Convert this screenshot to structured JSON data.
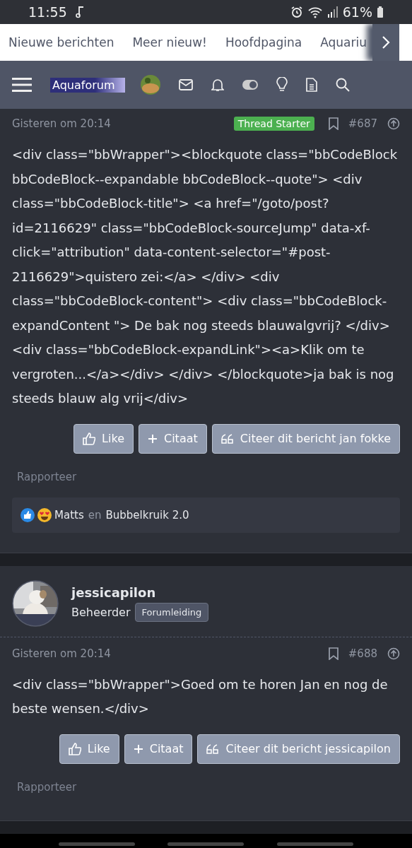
{
  "status_bar": {
    "time": "11:55",
    "battery": "61%"
  },
  "nav_tabs": [
    {
      "label": "Nieuwe berichten"
    },
    {
      "label": "Meer nieuw!"
    },
    {
      "label": "Hoofdpagina"
    },
    {
      "label": "Aquariu"
    }
  ],
  "header": {
    "logo": "Aquaforum"
  },
  "posts": [
    {
      "date": "Gisteren om 20:14",
      "badge": "Thread Starter",
      "number": "#687",
      "body": "<div class=\"bbWrapper\"><blockquote class=\"bbCodeBlock bbCodeBlock--expandable bbCodeBlock--quote\"> <div class=\"bbCodeBlock-title\"> <a href=\"/goto/post?id=2116629\" class=\"bbCodeBlock-sourceJump\" data-xf-click=\"attribution\" data-content-selector=\"#post-2116629\">quistero zei:</a> </div> <div class=\"bbCodeBlock-content\"> <div class=\"bbCodeBlock-expandContent \"> De bak nog steeds blauwalgvrij? </div> <div class=\"bbCodeBlock-expandLink\"><a>Klik om te vergroten...</a></div> </div> </blockquote>ja bak is nog steeds blauw alg vrij</div>",
      "buttons": [
        "Like",
        "Citaat",
        "Citeer dit bericht jan fokke"
      ],
      "report": "Rapporteer",
      "reactions": {
        "users": [
          "Matts",
          "Bubbelkruik 2.0"
        ],
        "joiner": "en"
      }
    },
    {
      "author": {
        "name": "jessicapilon",
        "role": "Beheerder",
        "tag": "Forumleiding"
      },
      "date": "Gisteren om 20:14",
      "number": "#688",
      "body": "<div class=\"bbWrapper\">Goed om te horen Jan en nog de beste wensen.</div>",
      "buttons": [
        "Like",
        "Citaat",
        "Citeer dit bericht jessicapilon"
      ],
      "report": "Rapporteer"
    }
  ]
}
